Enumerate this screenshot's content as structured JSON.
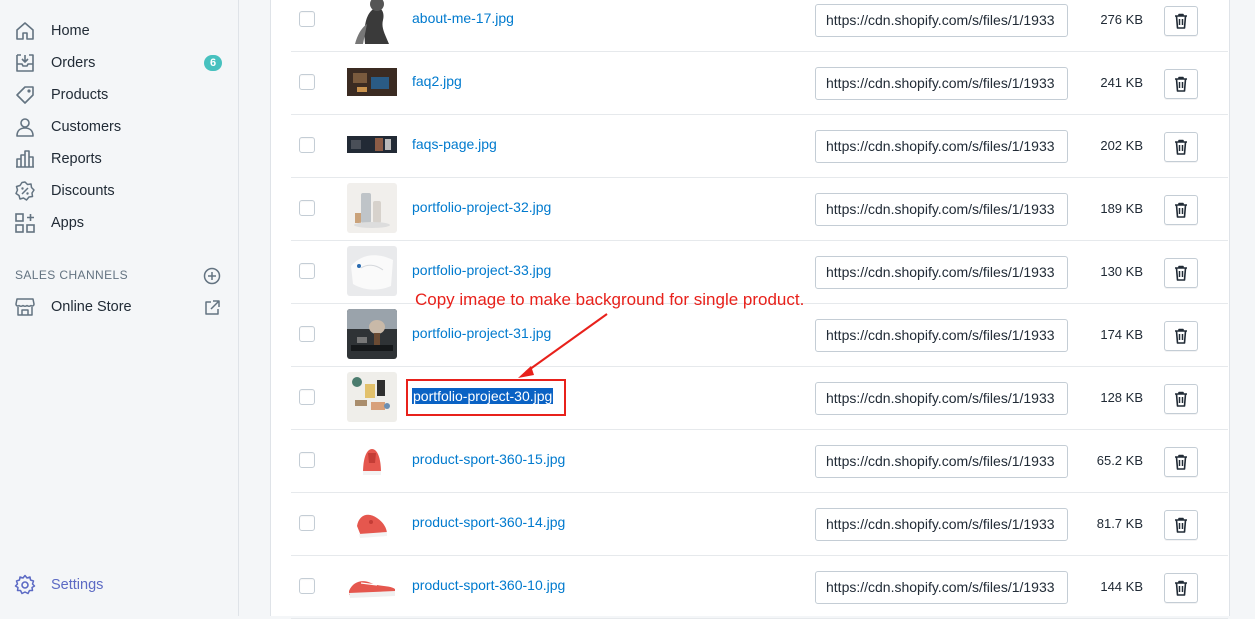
{
  "sidebar": {
    "items": [
      {
        "label": "Home",
        "icon": "home-icon"
      },
      {
        "label": "Orders",
        "icon": "orders-icon",
        "badge": "6"
      },
      {
        "label": "Products",
        "icon": "tag-icon"
      },
      {
        "label": "Customers",
        "icon": "person-icon"
      },
      {
        "label": "Reports",
        "icon": "bar-chart-icon"
      },
      {
        "label": "Discounts",
        "icon": "discount-icon"
      },
      {
        "label": "Apps",
        "icon": "apps-icon"
      }
    ],
    "sales_channels_title": "SALES CHANNELS",
    "online_store": {
      "label": "Online Store",
      "icon": "store-icon"
    },
    "settings": {
      "label": "Settings",
      "icon": "gear-icon"
    }
  },
  "files": [
    {
      "name": "about-me-17.jpg",
      "url": "https://cdn.shopify.com/s/files/1/1933",
      "size": "276 KB",
      "thumb": "portrait"
    },
    {
      "name": "faq2.jpg",
      "url": "https://cdn.shopify.com/s/files/1/1933",
      "size": "241 KB",
      "thumb": "dark-desk"
    },
    {
      "name": "faqs-page.jpg",
      "url": "https://cdn.shopify.com/s/files/1/1933",
      "size": "202 KB",
      "thumb": "dark-strip"
    },
    {
      "name": "portfolio-project-32.jpg",
      "url": "https://cdn.shopify.com/s/files/1/1933",
      "size": "189 KB",
      "thumb": "bottles"
    },
    {
      "name": "portfolio-project-33.jpg",
      "url": "https://cdn.shopify.com/s/files/1/1933",
      "size": "130 KB",
      "thumb": "white-cloth"
    },
    {
      "name": "portfolio-project-31.jpg",
      "url": "https://cdn.shopify.com/s/files/1/1933",
      "size": "174 KB",
      "thumb": "shave-brush"
    },
    {
      "name": "portfolio-project-30.jpg",
      "url": "https://cdn.shopify.com/s/files/1/1933",
      "size": "128 KB",
      "thumb": "cosmetics",
      "selected": true
    },
    {
      "name": "product-sport-360-15.jpg",
      "url": "https://cdn.shopify.com/s/files/1/1933",
      "size": "65.2 KB",
      "thumb": "shoe-front"
    },
    {
      "name": "product-sport-360-14.jpg",
      "url": "https://cdn.shopify.com/s/files/1/1933",
      "size": "81.7 KB",
      "thumb": "shoe-angle"
    },
    {
      "name": "product-sport-360-10.jpg",
      "url": "https://cdn.shopify.com/s/files/1/1933",
      "size": "144 KB",
      "thumb": "shoe-side"
    }
  ],
  "annotation": {
    "text": "Copy image to make background for single product.",
    "color": "#e8211b"
  },
  "colors": {
    "link": "#007ace",
    "badge": "#47c1bf",
    "selection": "#0a62c4",
    "settings": "#5c6ac4"
  }
}
